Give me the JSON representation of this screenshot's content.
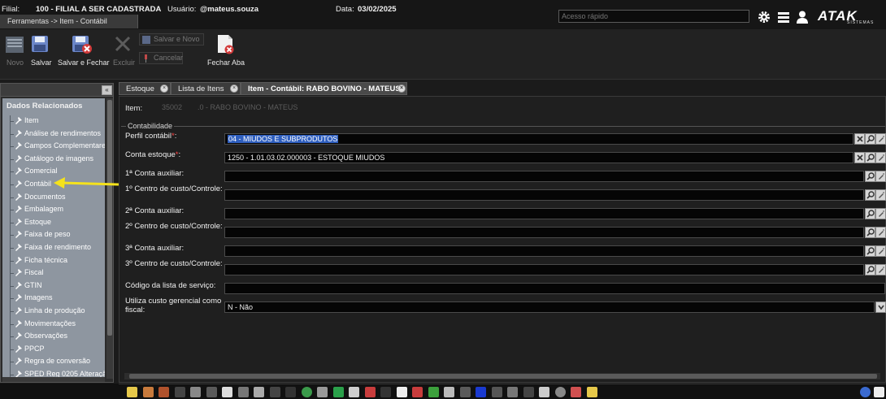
{
  "header": {
    "filial_label": "Filial:",
    "filial_value": "100 - FILIAL A SER CADASTRADA",
    "usuario_label": "Usuário:",
    "usuario_value": "@mateus.souza",
    "data_label": "Data:",
    "data_value": "03/02/2025",
    "quick_access_placeholder": "Acesso rápido",
    "logo_text": "ATAK",
    "logo_sub": "SISTEMAS"
  },
  "breadcrumb": "Ferramentas -> Item - Contábil",
  "toolbar": {
    "novo": "Novo",
    "salvar": "Salvar",
    "salvar_fechar": "Salvar e Fechar",
    "excluir": "Excluir",
    "salvar_novo": "Salvar e Novo",
    "cancelar": "Cancelar",
    "fechar_aba": "Fechar Aba"
  },
  "sidebar": {
    "title": "Dados Relacionados",
    "items": [
      "Item",
      "Análise de rendimentos",
      "Campos Complementares",
      "Catálogo de imagens",
      "Comercial",
      "Contábil",
      "Documentos",
      "Embalagem",
      "Estoque",
      "Faixa de peso",
      "Faixa de rendimento",
      "Ficha técnica",
      "Fiscal",
      "GTIN",
      "Imagens",
      "Linha de produção",
      "Movimentações",
      "Observações",
      "PPCP",
      "Regra de conversão",
      "SPED Reg 0205 Alteração"
    ]
  },
  "tabs": [
    {
      "label": "Estoque"
    },
    {
      "label": "Lista de Itens"
    },
    {
      "label": "Item - Contábil: RABO BOVINO - MATEUS"
    }
  ],
  "item": {
    "label": "Item:",
    "code": "35002",
    "name": ".0 - RABO BOVINO - MATEUS"
  },
  "group_title": "Contabilidade",
  "fields": [
    {
      "label": "Perfil contábil",
      "required": "*",
      "suffix": ":",
      "value": "04  - MIUDOS E SUBPRODUTOS"
    },
    {
      "label": "Conta estoque",
      "required": "*",
      "suffix": ":",
      "value": "1250 - 1.01.03.02.000003 - ESTOQUE MIUDOS"
    },
    {
      "label": "1ª Conta auxiliar:",
      "value": ""
    },
    {
      "label": "1º Centro de custo/Controle:",
      "value": ""
    },
    {
      "label": "2ª Conta auxiliar:",
      "value": ""
    },
    {
      "label": "2º Centro de custo/Controle:",
      "value": ""
    },
    {
      "label": "3ª Conta auxiliar:",
      "value": ""
    },
    {
      "label": "3º Centro de custo/Controle:",
      "value": ""
    },
    {
      "label": "Código da lista de serviço:",
      "value": ""
    },
    {
      "label": "Utiliza custo gerencial como fiscal:",
      "value": "N - Não"
    }
  ],
  "colors": {
    "background": "#1b1b1b",
    "sidebar_list": "#8e96a0",
    "selection": "#2f5fbf",
    "required": "#ff4545",
    "arrow": "#f5e21c"
  }
}
